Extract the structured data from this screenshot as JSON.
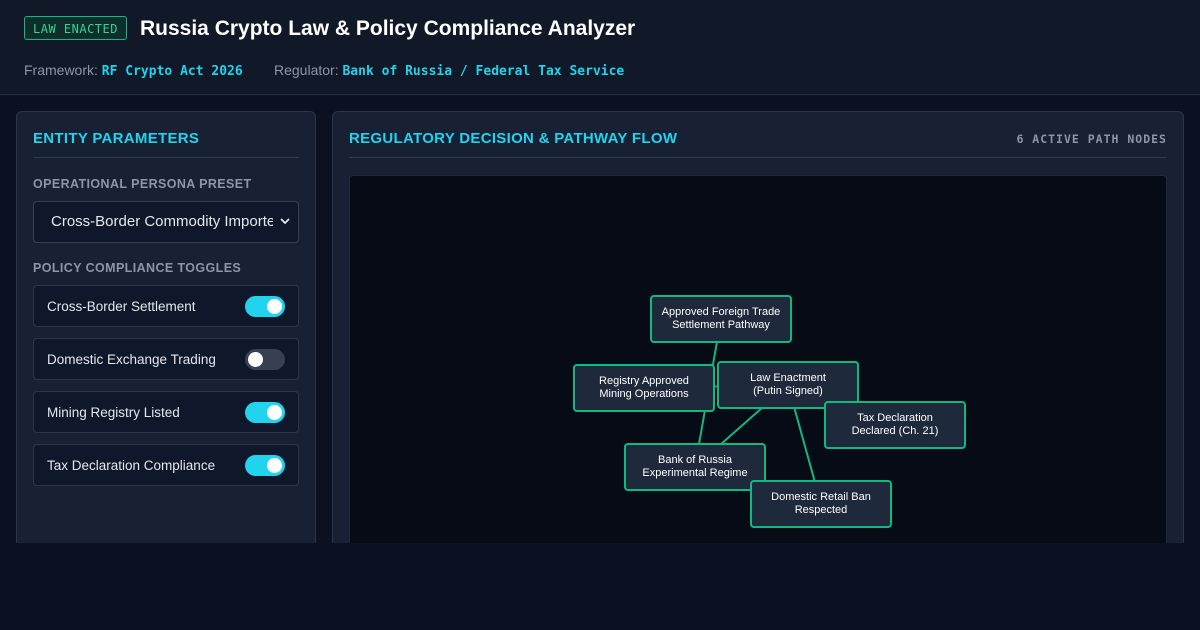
{
  "header": {
    "badge": "LAW ENACTED",
    "title": "Russia Crypto Law & Policy Compliance Analyzer",
    "framework_label": "Framework:",
    "framework_value": "RF Crypto Act 2026",
    "regulator_label": "Regulator:",
    "regulator_value": "Bank of Russia / Federal Tax Service"
  },
  "entity_panel": {
    "title": "ENTITY PARAMETERS",
    "persona_label": "OPERATIONAL PERSONA PRESET",
    "persona_selected": "Cross-Border Commodity Importer",
    "toggles_label": "POLICY COMPLIANCE TOGGLES",
    "toggles": [
      {
        "label": "Cross-Border Settlement",
        "on": true
      },
      {
        "label": "Domestic Exchange Trading",
        "on": false
      },
      {
        "label": "Mining Registry Listed",
        "on": true
      },
      {
        "label": "Tax Declaration Compliance",
        "on": true
      }
    ]
  },
  "flow_panel": {
    "title": "REGULATORY DECISION & PATHWAY FLOW",
    "node_count": "6 ACTIVE PATH NODES",
    "nodes": [
      {
        "id": "foreign",
        "label": "Approved Foreign Trade\nSettlement Pathway"
      },
      {
        "id": "mining",
        "label": "Registry Approved\nMining Operations"
      },
      {
        "id": "law",
        "label": "Law Enactment\n(Putin Signed)"
      },
      {
        "id": "tax",
        "label": "Tax Declaration\nDeclared (Ch. 21)"
      },
      {
        "id": "bank",
        "label": "Bank of Russia\nExperimental Regime"
      },
      {
        "id": "retail",
        "label": "Domestic Retail Ban\nRespected"
      }
    ],
    "edges": [
      [
        "foreign",
        "bank"
      ],
      [
        "law",
        "bank"
      ],
      [
        "law",
        "retail"
      ],
      [
        "mining",
        "law"
      ]
    ]
  },
  "colors": {
    "accent": "#22d3ee",
    "node_border": "#10b981",
    "badge_text": "#34d399"
  }
}
